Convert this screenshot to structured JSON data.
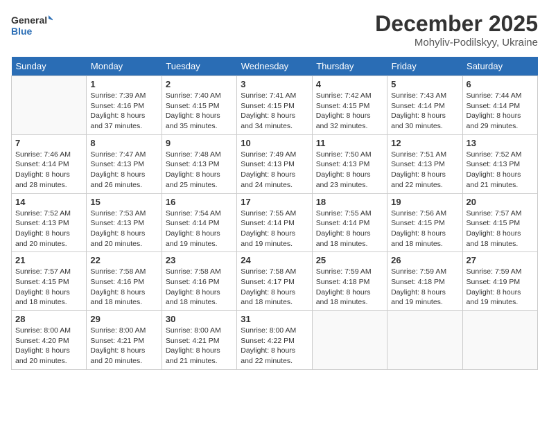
{
  "header": {
    "logo_line1": "General",
    "logo_line2": "Blue",
    "month": "December 2025",
    "location": "Mohyliv-Podilskyy, Ukraine"
  },
  "weekdays": [
    "Sunday",
    "Monday",
    "Tuesday",
    "Wednesday",
    "Thursday",
    "Friday",
    "Saturday"
  ],
  "weeks": [
    [
      {
        "day": "",
        "info": ""
      },
      {
        "day": "1",
        "info": "Sunrise: 7:39 AM\nSunset: 4:16 PM\nDaylight: 8 hours\nand 37 minutes."
      },
      {
        "day": "2",
        "info": "Sunrise: 7:40 AM\nSunset: 4:15 PM\nDaylight: 8 hours\nand 35 minutes."
      },
      {
        "day": "3",
        "info": "Sunrise: 7:41 AM\nSunset: 4:15 PM\nDaylight: 8 hours\nand 34 minutes."
      },
      {
        "day": "4",
        "info": "Sunrise: 7:42 AM\nSunset: 4:15 PM\nDaylight: 8 hours\nand 32 minutes."
      },
      {
        "day": "5",
        "info": "Sunrise: 7:43 AM\nSunset: 4:14 PM\nDaylight: 8 hours\nand 30 minutes."
      },
      {
        "day": "6",
        "info": "Sunrise: 7:44 AM\nSunset: 4:14 PM\nDaylight: 8 hours\nand 29 minutes."
      }
    ],
    [
      {
        "day": "7",
        "info": "Sunrise: 7:46 AM\nSunset: 4:14 PM\nDaylight: 8 hours\nand 28 minutes."
      },
      {
        "day": "8",
        "info": "Sunrise: 7:47 AM\nSunset: 4:13 PM\nDaylight: 8 hours\nand 26 minutes."
      },
      {
        "day": "9",
        "info": "Sunrise: 7:48 AM\nSunset: 4:13 PM\nDaylight: 8 hours\nand 25 minutes."
      },
      {
        "day": "10",
        "info": "Sunrise: 7:49 AM\nSunset: 4:13 PM\nDaylight: 8 hours\nand 24 minutes."
      },
      {
        "day": "11",
        "info": "Sunrise: 7:50 AM\nSunset: 4:13 PM\nDaylight: 8 hours\nand 23 minutes."
      },
      {
        "day": "12",
        "info": "Sunrise: 7:51 AM\nSunset: 4:13 PM\nDaylight: 8 hours\nand 22 minutes."
      },
      {
        "day": "13",
        "info": "Sunrise: 7:52 AM\nSunset: 4:13 PM\nDaylight: 8 hours\nand 21 minutes."
      }
    ],
    [
      {
        "day": "14",
        "info": "Sunrise: 7:52 AM\nSunset: 4:13 PM\nDaylight: 8 hours\nand 20 minutes."
      },
      {
        "day": "15",
        "info": "Sunrise: 7:53 AM\nSunset: 4:13 PM\nDaylight: 8 hours\nand 20 minutes."
      },
      {
        "day": "16",
        "info": "Sunrise: 7:54 AM\nSunset: 4:14 PM\nDaylight: 8 hours\nand 19 minutes."
      },
      {
        "day": "17",
        "info": "Sunrise: 7:55 AM\nSunset: 4:14 PM\nDaylight: 8 hours\nand 19 minutes."
      },
      {
        "day": "18",
        "info": "Sunrise: 7:55 AM\nSunset: 4:14 PM\nDaylight: 8 hours\nand 18 minutes."
      },
      {
        "day": "19",
        "info": "Sunrise: 7:56 AM\nSunset: 4:15 PM\nDaylight: 8 hours\nand 18 minutes."
      },
      {
        "day": "20",
        "info": "Sunrise: 7:57 AM\nSunset: 4:15 PM\nDaylight: 8 hours\nand 18 minutes."
      }
    ],
    [
      {
        "day": "21",
        "info": "Sunrise: 7:57 AM\nSunset: 4:15 PM\nDaylight: 8 hours\nand 18 minutes."
      },
      {
        "day": "22",
        "info": "Sunrise: 7:58 AM\nSunset: 4:16 PM\nDaylight: 8 hours\nand 18 minutes."
      },
      {
        "day": "23",
        "info": "Sunrise: 7:58 AM\nSunset: 4:16 PM\nDaylight: 8 hours\nand 18 minutes."
      },
      {
        "day": "24",
        "info": "Sunrise: 7:58 AM\nSunset: 4:17 PM\nDaylight: 8 hours\nand 18 minutes."
      },
      {
        "day": "25",
        "info": "Sunrise: 7:59 AM\nSunset: 4:18 PM\nDaylight: 8 hours\nand 18 minutes."
      },
      {
        "day": "26",
        "info": "Sunrise: 7:59 AM\nSunset: 4:18 PM\nDaylight: 8 hours\nand 19 minutes."
      },
      {
        "day": "27",
        "info": "Sunrise: 7:59 AM\nSunset: 4:19 PM\nDaylight: 8 hours\nand 19 minutes."
      }
    ],
    [
      {
        "day": "28",
        "info": "Sunrise: 8:00 AM\nSunset: 4:20 PM\nDaylight: 8 hours\nand 20 minutes."
      },
      {
        "day": "29",
        "info": "Sunrise: 8:00 AM\nSunset: 4:21 PM\nDaylight: 8 hours\nand 20 minutes."
      },
      {
        "day": "30",
        "info": "Sunrise: 8:00 AM\nSunset: 4:21 PM\nDaylight: 8 hours\nand 21 minutes."
      },
      {
        "day": "31",
        "info": "Sunrise: 8:00 AM\nSunset: 4:22 PM\nDaylight: 8 hours\nand 22 minutes."
      },
      {
        "day": "",
        "info": ""
      },
      {
        "day": "",
        "info": ""
      },
      {
        "day": "",
        "info": ""
      }
    ]
  ]
}
